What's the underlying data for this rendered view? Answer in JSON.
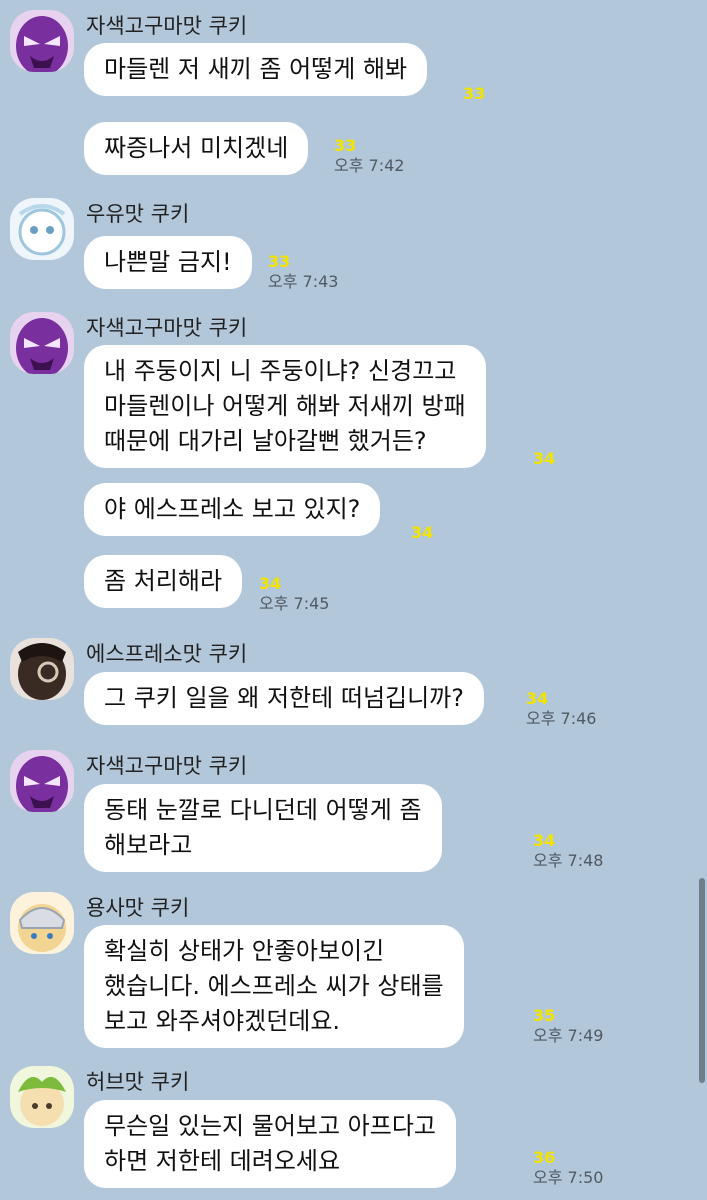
{
  "colors": {
    "background": "#b2c7d9",
    "bubble": "#ffffff",
    "unread": "#f2e400",
    "time": "#505a63"
  },
  "chat": {
    "groups": [
      {
        "sender": "자색고구마맛 쿠키",
        "avatar": "purple-yam-cookie-avatar",
        "messages": [
          {
            "text": "마들렌 저 새끼 좀 어떻게 해봐",
            "unread": "33",
            "time": ""
          },
          {
            "text": "짜증나서 미치겠네",
            "unread": "33",
            "time": "오후 7:42"
          }
        ]
      },
      {
        "sender": "우유맛 쿠키",
        "avatar": "milk-cookie-avatar",
        "messages": [
          {
            "text": "나쁜말 금지!",
            "unread": "33",
            "time": "오후 7:43"
          }
        ]
      },
      {
        "sender": "자색고구마맛 쿠키",
        "avatar": "purple-yam-cookie-avatar",
        "messages": [
          {
            "text": "내 주둥이지 니 주둥이냐? 신경끄고\n마들렌이나 어떻게 해봐 저새끼 방패\n때문에 대가리 날아갈뻔 했거든?",
            "unread": "34",
            "time": ""
          },
          {
            "text": "야 에스프레소 보고 있지?",
            "unread": "34",
            "time": ""
          },
          {
            "text": "좀 처리해라",
            "unread": "34",
            "time": "오후 7:45"
          }
        ]
      },
      {
        "sender": "에스프레소맛 쿠키",
        "avatar": "espresso-cookie-avatar",
        "messages": [
          {
            "text": "그 쿠키 일을 왜 저한테 떠넘깁니까?",
            "unread": "34",
            "time": "오후 7:46"
          }
        ]
      },
      {
        "sender": "자색고구마맛 쿠키",
        "avatar": "purple-yam-cookie-avatar",
        "messages": [
          {
            "text": "동태 눈깔로 다니던데 어떻게 좀\n해보라고",
            "unread": "34",
            "time": "오후 7:48"
          }
        ]
      },
      {
        "sender": "용사맛 쿠키",
        "avatar": "knight-cookie-avatar",
        "messages": [
          {
            "text": "확실히 상태가 안좋아보이긴\n했습니다. 에스프레소 씨가 상태를\n보고 와주셔야겠던데요.",
            "unread": "35",
            "time": "오후 7:49"
          }
        ]
      },
      {
        "sender": "허브맛 쿠키",
        "avatar": "herb-cookie-avatar",
        "messages": [
          {
            "text": "무슨일 있는지 물어보고 아프다고\n하면 저한테 데려오세요",
            "unread": "36",
            "time": "오후 7:50"
          }
        ]
      }
    ]
  }
}
